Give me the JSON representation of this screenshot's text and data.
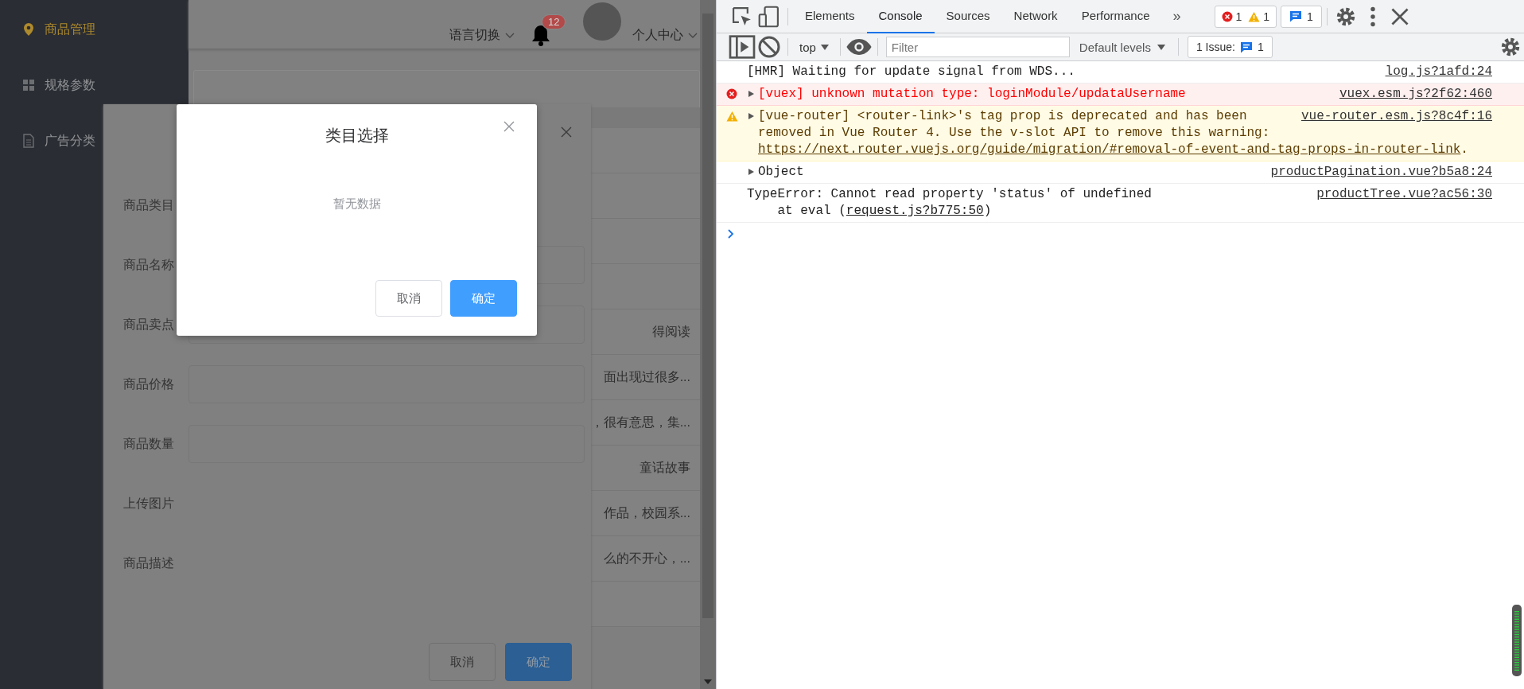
{
  "app": {
    "sidebar": {
      "items": [
        {
          "label": "商品管理",
          "kind": "pin",
          "selected": true
        },
        {
          "label": "规格参数",
          "kind": "grid",
          "selected": false
        },
        {
          "label": "广告分类",
          "kind": "doc",
          "selected": false
        }
      ]
    },
    "header": {
      "language": "语言切换",
      "notification_count": "12",
      "user_menu": "个人中心"
    },
    "table": {
      "rows": [
        {
          "text": "得阅读"
        },
        {
          "text": "面出现过很多..."
        },
        {
          "text": "，很有意思，集..."
        },
        {
          "text": "童话故事"
        },
        {
          "text": "作品，校园系..."
        },
        {
          "text": "么的不开心，..."
        }
      ]
    },
    "product_dialog": {
      "fields": [
        {
          "label": "商品类目",
          "kind": "none"
        },
        {
          "label": "商品名称",
          "kind": "input"
        },
        {
          "label": "商品卖点",
          "kind": "input"
        },
        {
          "label": "商品价格",
          "kind": "input"
        },
        {
          "label": "商品数量",
          "kind": "input"
        },
        {
          "label": "上传图片",
          "kind": "none"
        },
        {
          "label": "商品描述",
          "kind": "none"
        }
      ],
      "buttons": [
        {
          "label": "取消",
          "kind": "default"
        },
        {
          "label": "确定",
          "kind": "primary"
        }
      ]
    },
    "category_dialog": {
      "title": "类目选择",
      "empty_text": "暂无数据",
      "buttons": [
        {
          "label": "取消",
          "kind": "default"
        },
        {
          "label": "确定",
          "kind": "primary"
        }
      ]
    }
  },
  "devtools": {
    "tabs": [
      {
        "label": "Elements",
        "selected": false
      },
      {
        "label": "Console",
        "selected": true
      },
      {
        "label": "Sources",
        "selected": false
      },
      {
        "label": "Network",
        "selected": false
      },
      {
        "label": "Performance",
        "selected": false
      }
    ],
    "overflow": "»",
    "error_count": "1",
    "warning_count": "1",
    "message_count": "1",
    "context": "top",
    "filter_placeholder": "Filter",
    "levels": "Default levels",
    "issues_label": "1 Issue:",
    "issues_count": "1",
    "messages": [
      {
        "kind": "info",
        "expandable": false,
        "text": "[HMR] Waiting for update signal from WDS...",
        "source": "log.js?1afd:24"
      },
      {
        "kind": "error",
        "expandable": true,
        "text": "[vuex] unknown mutation type: loginModule/updataUsername",
        "source": "vuex.esm.js?2f62:460"
      },
      {
        "kind": "warning",
        "expandable": true,
        "text": "[vue-router] <router-link>'s tag prop is deprecated and has been removed in Vue Router 4. Use the v-slot API to remove this warning: ",
        "link": "https://next.router.vuejs.org/guide/migration/#removal-of-event-and-tag-props-in-router-link",
        "after_link": ".",
        "source": "vue-router.esm.js?8c4f:16"
      },
      {
        "kind": "info",
        "expandable": true,
        "text": "Object",
        "source": "productPagination.vue?b5a8:24"
      },
      {
        "kind": "info",
        "expandable": false,
        "text": "TypeError: Cannot read property 'status' of undefined",
        "stack": {
          "text": "at eval (",
          "link": "request.js?b775:50",
          "after_link": ")"
        },
        "source": "productTree.vue?ac56:30"
      }
    ]
  }
}
